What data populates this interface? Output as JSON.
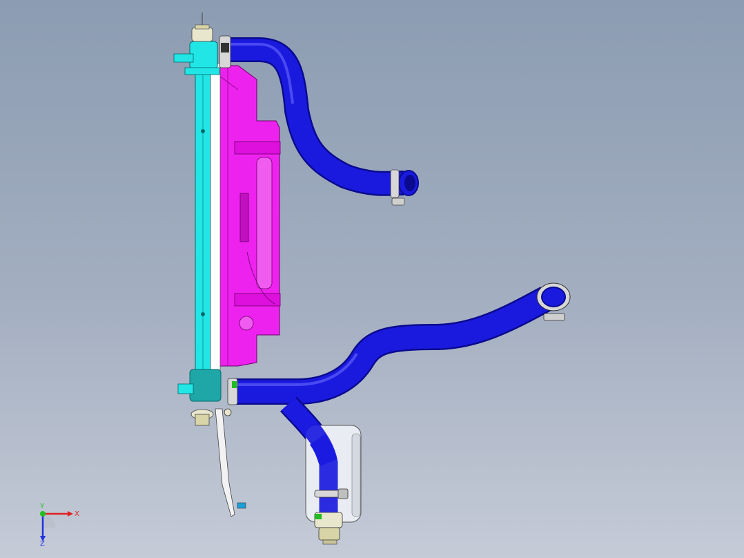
{
  "viewport": {
    "colors": {
      "background_top": "#8c9cb2",
      "background_bottom": "#c5cbd7",
      "hose": "#1a1adf",
      "hose_dark": "#0a0a8f",
      "shroud": "#ee22ee",
      "radiator_tank": "#22e6e6",
      "reservoir": "#e9ecf2",
      "clamp": "#d7d7d7",
      "bracket": "#f2f2f2",
      "fitting": "#e8e6cc"
    },
    "parts": {
      "radiator": "radiator-core",
      "fan_shroud": "fan-shroud",
      "upper_hose": "upper-hose",
      "lower_hose": "lower-hose",
      "overflow_hose": "overflow-hose",
      "reservoir": "coolant-reservoir"
    }
  },
  "triad": {
    "x_label": "X",
    "y_label": "Y",
    "z_label": "Z",
    "x_color": "#e02020",
    "y_color": "#20c020",
    "z_color": "#2030e0"
  }
}
